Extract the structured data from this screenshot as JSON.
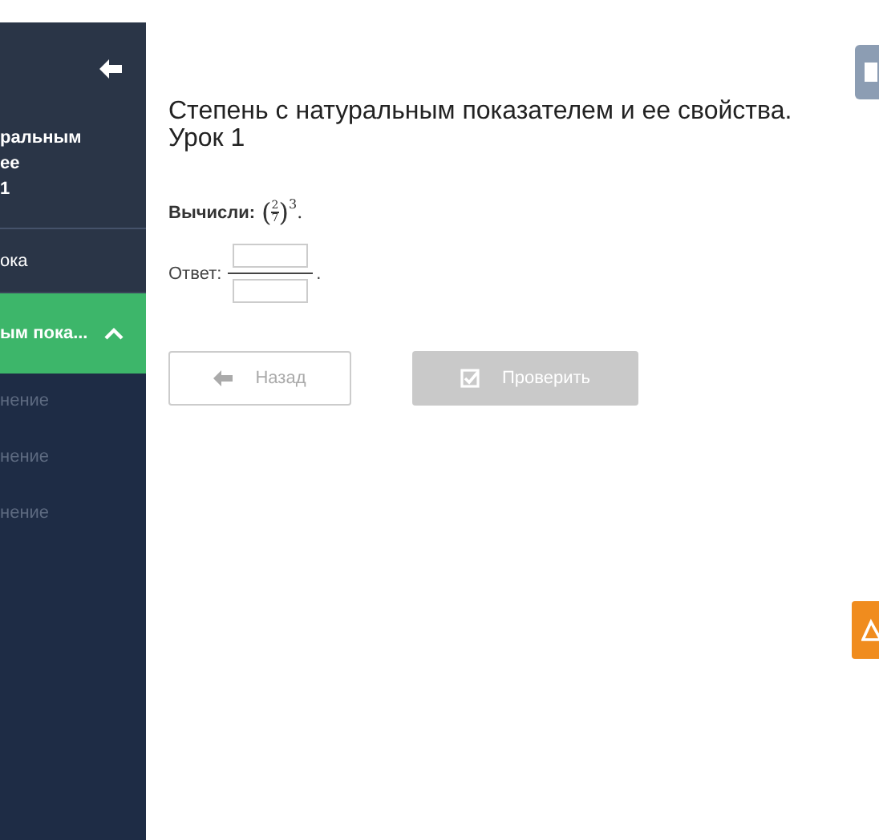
{
  "sidebar": {
    "title_lines": [
      "ральным",
      "ее",
      "1"
    ],
    "items": [
      {
        "text": "ока",
        "selected": false
      },
      {
        "text": "ым пока...",
        "selected": true,
        "expanded": true,
        "children": [
          {
            "text": "нение",
            "selected": false
          },
          {
            "text": "нение",
            "selected": false
          },
          {
            "text": "нение",
            "selected": false
          }
        ]
      }
    ]
  },
  "main": {
    "title": "Степень с натуральным показателем и ее свойства. Урок 1",
    "task": {
      "label": "Вычисли:",
      "open": "(",
      "close": ")",
      "numerator": "2",
      "denominator": "7",
      "exponent": "3",
      "end": "."
    },
    "answer": {
      "label": "Ответ:",
      "end": "."
    },
    "buttons": [
      {
        "kind": "back",
        "label": "Назад",
        "disabled": false
      },
      {
        "kind": "check",
        "label": "Проверить",
        "disabled": true
      }
    ]
  }
}
